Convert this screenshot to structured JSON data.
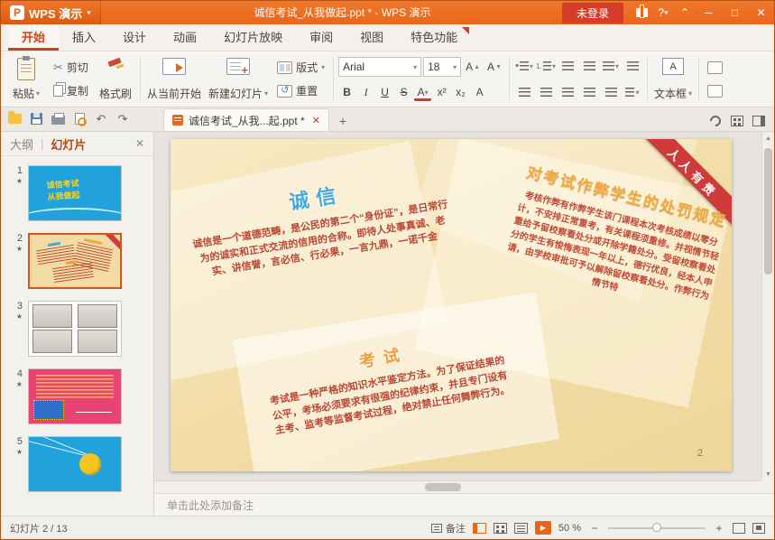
{
  "icons": {
    "dropdown": "▾",
    "scissors": "✂",
    "close": "✕",
    "minimize": "─",
    "maximize": "□",
    "collapse": "⌃",
    "help": "?",
    "undo": "↶",
    "redo": "↷",
    "plus": "+",
    "star": "★",
    "pipe": "|",
    "up": "▲",
    "down": "▼",
    "play": "▶",
    "minus": "−",
    "bullet": "•",
    "number_one": "1."
  },
  "titlebar": {
    "app_name": "WPS 演示",
    "document_title": "诚信考试_从我做起.ppt * - WPS 演示",
    "login": "未登录"
  },
  "tabs": {
    "items": [
      "开始",
      "插入",
      "设计",
      "动画",
      "幻灯片放映",
      "审阅",
      "视图",
      "特色功能"
    ]
  },
  "ribbon": {
    "paste": "粘贴",
    "cut": "剪切",
    "copy": "复制",
    "format_painter": "格式刷",
    "from_current": "从当前开始",
    "new_slide": "新建幻灯片",
    "reset": "重置",
    "layout": "版式",
    "font_name": "Arial",
    "font_size": "18",
    "inc_font": "A",
    "dec_font": "A",
    "bold": "B",
    "italic": "I",
    "underline": "U",
    "strike": "S",
    "font_color": "A",
    "superscript": "x²",
    "subscript": "x₂",
    "clear_format": "A",
    "text_box": "文本框"
  },
  "doc_toolbar": {
    "tab_title": "诚信考试_从我...起.ppt *"
  },
  "sidebar": {
    "outline_tab": "大纲",
    "slides_tab": "幻灯片",
    "slides": [
      {
        "number": "1",
        "preview_line1": "诚信考试",
        "preview_line2": "从我做起"
      },
      {
        "number": "2"
      },
      {
        "number": "3"
      },
      {
        "number": "4"
      },
      {
        "number": "5"
      }
    ]
  },
  "slide": {
    "corner_ribbon": "人人有责",
    "page_number": "2",
    "integrity_title": "诚信",
    "integrity_body": "诚信是一个道德范畴，是公民的第二个“身份证”，是日常行为的诚实和正式交流的信用的合称。即待人处事真诚、老实、讲信誉，言必信、行必果，一言九鼎，一诺千金",
    "punish_title": "对考试作弊学生的处罚规定",
    "punish_body": "考核作弊有作弊学生该门课程本次考核成绩以零分计，不安排正常重考，有关课程须重修。并视情节轻重给予留校察看处分或开除学籍处分。受留校察看处分的学生有悛悔表现一年以上，德行优良，经本人申请，由学校审批可予以解除留校察看处分。作弊行为情节特",
    "exam_title": "考试",
    "exam_body": "考试是一种严格的知识水平鉴定方法。为了保证结果的公平，考场必须要求有很强的纪律约束，并且专门设有主考、监考等监督考试过程，绝对禁止任何舞弊行为。"
  },
  "notes": {
    "placeholder": "单击此处添加备注"
  },
  "statusbar": {
    "slide_indicator": "幻灯片 2 / 13",
    "notes_label": "备注",
    "zoom": "50 %"
  }
}
